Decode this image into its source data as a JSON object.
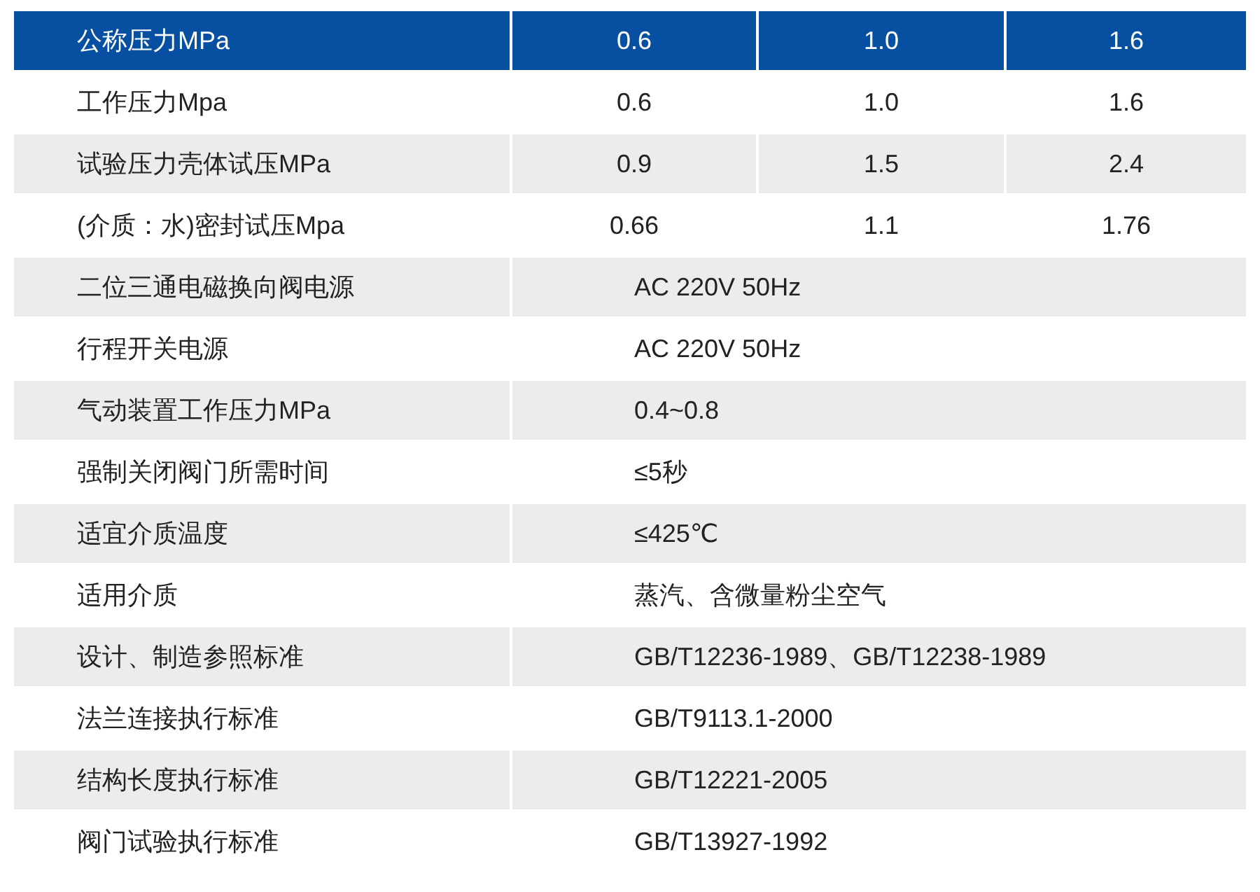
{
  "table": {
    "header": {
      "label": "公称压力MPa",
      "values": [
        "0.6",
        "1.0",
        "1.6"
      ]
    },
    "rows": [
      {
        "kind": "split",
        "label": "工作压力Mpa",
        "values": [
          "0.6",
          "1.0",
          "1.6"
        ]
      },
      {
        "kind": "split",
        "label": "试验压力壳体试压MPa",
        "values": [
          "0.9",
          "1.5",
          "2.4"
        ]
      },
      {
        "kind": "split",
        "label": "(介质：水)密封试压Mpa",
        "values": [
          "0.66",
          "1.1",
          "1.76"
        ]
      },
      {
        "kind": "span",
        "label": "二位三通电磁换向阀电源",
        "values": [
          "AC 220V 50Hz"
        ]
      },
      {
        "kind": "span",
        "label": "行程开关电源",
        "values": [
          "AC 220V 50Hz"
        ]
      },
      {
        "kind": "span",
        "label": "气动装置工作压力MPa",
        "values": [
          "0.4~0.8"
        ]
      },
      {
        "kind": "span",
        "label": "强制关闭阀门所需时间",
        "values": [
          "≤5秒"
        ]
      },
      {
        "kind": "span",
        "label": "适宜介质温度",
        "values": [
          "≤425℃"
        ]
      },
      {
        "kind": "span",
        "label": "适用介质",
        "values": [
          "蒸汽、含微量粉尘空气"
        ]
      },
      {
        "kind": "span",
        "label": "设计、制造参照标准",
        "values": [
          "GB/T12236-1989、GB/T12238-1989"
        ]
      },
      {
        "kind": "span",
        "label": "法兰连接执行标准",
        "values": [
          "GB/T9113.1-2000"
        ]
      },
      {
        "kind": "span",
        "label": "结构长度执行标准",
        "values": [
          "GB/T12221-2005"
        ]
      },
      {
        "kind": "span",
        "label": "阀门试验执行标准",
        "values": [
          "GB/T13927-1992"
        ]
      }
    ]
  }
}
